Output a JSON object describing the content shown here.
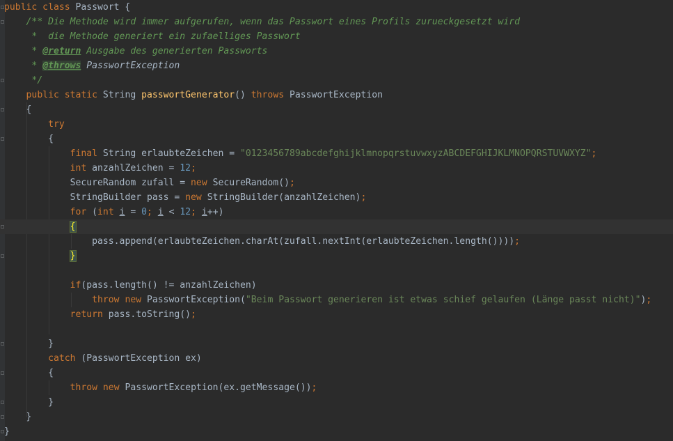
{
  "colors": {
    "background": "#2b2b2b",
    "keyword": "#cc7832",
    "method": "#ffc66d",
    "string": "#6a8759",
    "number": "#6897bb",
    "comment": "#629755",
    "text": "#a9b7c6"
  },
  "code": {
    "l1": {
      "kw": "public class ",
      "name": "Passwort {"
    },
    "l2": {
      "doc": "/** Die Methode wird immer aufgerufen, wenn das Passwort eines Profils zurueckgesetzt wird"
    },
    "l3": {
      "doc": " *  die Methode generiert ein zufaelliges Passwort"
    },
    "l4": {
      "star": " * ",
      "tag": "@return",
      "rest": " Ausgabe des generierten Passworts"
    },
    "l5": {
      "star": " * ",
      "tag": "@throws",
      "sp": " ",
      "ref": "PasswortException"
    },
    "l6": {
      "doc": " */"
    },
    "l7": {
      "kw1": "public static ",
      "type": "String ",
      "fn": "passwortGenerator",
      "paren": "() ",
      "kw2": "throws ",
      "exc": "PasswortException"
    },
    "l8": {
      "text": "{"
    },
    "l9": {
      "kw": "try"
    },
    "l10": {
      "text": "{"
    },
    "l11": {
      "kw": "final ",
      "a": "String erlaubteZeichen = ",
      "str": "\"0123456789abcdefghijklmnopqrstuvwxyzABCDEFGHIJKLMNOPQRSTUVWXYZ\"",
      "semi": ";"
    },
    "l12": {
      "kw": "int ",
      "a": "anzahlZeichen = ",
      "num": "12",
      "semi": ";"
    },
    "l13": {
      "a": "SecureRandom zufall = ",
      "kw": "new ",
      "b": "SecureRandom()",
      "semi": ";"
    },
    "l14": {
      "a": "StringBuilder pass = ",
      "kw": "new ",
      "b": "StringBuilder(anzahlZeichen)",
      "semi": ";"
    },
    "l15": {
      "kw1": "for ",
      "p1": "(",
      "kw2": "int ",
      "v1": "i",
      "eq": " = ",
      "n1": "0",
      "s1": "; ",
      "v2": "i",
      "lt": " < ",
      "n2": "12",
      "s2": "; ",
      "v3": "i",
      "inc": "++)"
    },
    "l16": {
      "brace": "{"
    },
    "l17": {
      "text": "pass.append(erlaubteZeichen.charAt(zufall.nextInt(erlaubteZeichen.length())))",
      "semi": ";"
    },
    "l18": {
      "brace": "}"
    },
    "l19": {
      "text": ""
    },
    "l20": {
      "kw": "if",
      "text": "(pass.length() != anzahlZeichen)"
    },
    "l21": {
      "kw1": "throw ",
      "kw2": "new ",
      "a": "PasswortException(",
      "str": "\"Beim Passwort generieren ist etwas schief gelaufen (Länge passt nicht)\"",
      "b": ")",
      "semi": ";"
    },
    "l22": {
      "kw": "return ",
      "a": "pass.toString()",
      "semi": ";"
    },
    "l23": {
      "text": ""
    },
    "l24": {
      "text": "}"
    },
    "l25": {
      "kw": "catch ",
      "text": "(PasswortException ex)"
    },
    "l26": {
      "text": "{"
    },
    "l27": {
      "kw1": "throw ",
      "kw2": "new ",
      "a": "PasswortException(ex.getMessage())",
      "semi": ";"
    },
    "l28": {
      "text": "}"
    },
    "l29": {
      "text": "}"
    },
    "l30": {
      "text": "}"
    }
  }
}
